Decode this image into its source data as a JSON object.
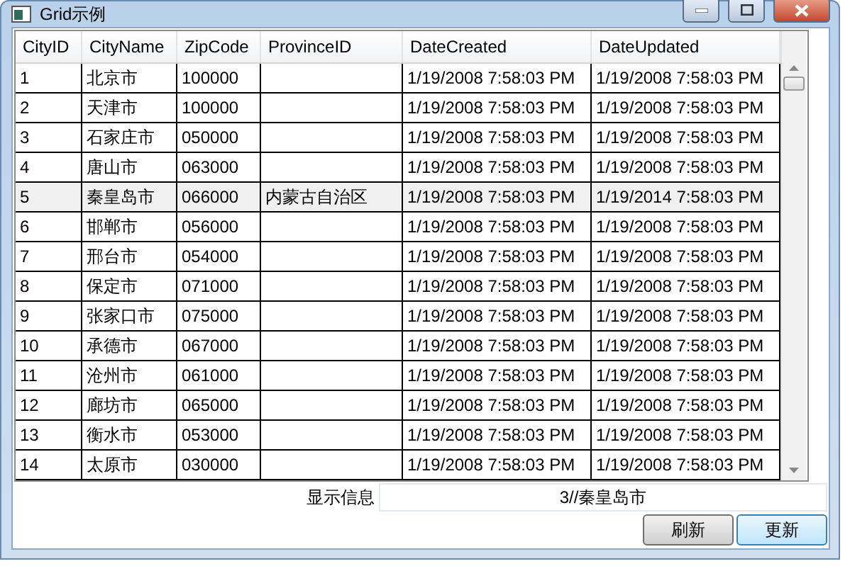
{
  "window": {
    "title": "Grid示例"
  },
  "table": {
    "columns": [
      "CityID",
      "CityName",
      "ZipCode",
      "ProvinceID",
      "DateCreated",
      "DateUpdated"
    ],
    "rows": [
      {
        "selected": false,
        "cells": [
          "1",
          "北京市",
          "100000",
          "",
          "1/19/2008 7:58:03 PM",
          "1/19/2008 7:58:03 PM"
        ]
      },
      {
        "selected": false,
        "cells": [
          "2",
          "天津市",
          "100000",
          "",
          "1/19/2008 7:58:03 PM",
          "1/19/2008 7:58:03 PM"
        ]
      },
      {
        "selected": false,
        "cells": [
          "3",
          "石家庄市",
          "050000",
          "",
          "1/19/2008 7:58:03 PM",
          "1/19/2008 7:58:03 PM"
        ]
      },
      {
        "selected": false,
        "cells": [
          "4",
          "唐山市",
          "063000",
          "",
          "1/19/2008 7:58:03 PM",
          "1/19/2008 7:58:03 PM"
        ]
      },
      {
        "selected": true,
        "cells": [
          "5",
          "秦皇岛市",
          "066000",
          "内蒙古自治区",
          "1/19/2008 7:58:03 PM",
          "1/19/2014 7:58:03 PM"
        ]
      },
      {
        "selected": false,
        "cells": [
          "6",
          "邯郸市",
          "056000",
          "",
          "1/19/2008 7:58:03 PM",
          "1/19/2008 7:58:03 PM"
        ]
      },
      {
        "selected": false,
        "cells": [
          "7",
          "邢台市",
          "054000",
          "",
          "1/19/2008 7:58:03 PM",
          "1/19/2008 7:58:03 PM"
        ]
      },
      {
        "selected": false,
        "cells": [
          "8",
          "保定市",
          "071000",
          "",
          "1/19/2008 7:58:03 PM",
          "1/19/2008 7:58:03 PM"
        ]
      },
      {
        "selected": false,
        "cells": [
          "9",
          "张家口市",
          "075000",
          "",
          "1/19/2008 7:58:03 PM",
          "1/19/2008 7:58:03 PM"
        ]
      },
      {
        "selected": false,
        "cells": [
          "10",
          "承德市",
          "067000",
          "",
          "1/19/2008 7:58:03 PM",
          "1/19/2008 7:58:03 PM"
        ]
      },
      {
        "selected": false,
        "cells": [
          "11",
          "沧州市",
          "061000",
          "",
          "1/19/2008 7:58:03 PM",
          "1/19/2008 7:58:03 PM"
        ]
      },
      {
        "selected": false,
        "cells": [
          "12",
          "廊坊市",
          "065000",
          "",
          "1/19/2008 7:58:03 PM",
          "1/19/2008 7:58:03 PM"
        ]
      },
      {
        "selected": false,
        "cells": [
          "13",
          "衡水市",
          "053000",
          "",
          "1/19/2008 7:58:03 PM",
          "1/19/2008 7:58:03 PM"
        ]
      },
      {
        "selected": false,
        "cells": [
          "14",
          "太原市",
          "030000",
          "",
          "1/19/2008 7:58:03 PM",
          "1/19/2008 7:58:03 PM"
        ]
      }
    ]
  },
  "info": {
    "label": "显示信息",
    "value": "3//秦皇岛市"
  },
  "buttons": [
    {
      "label": "刷新",
      "selected": false
    },
    {
      "label": "更新",
      "selected": true
    }
  ]
}
